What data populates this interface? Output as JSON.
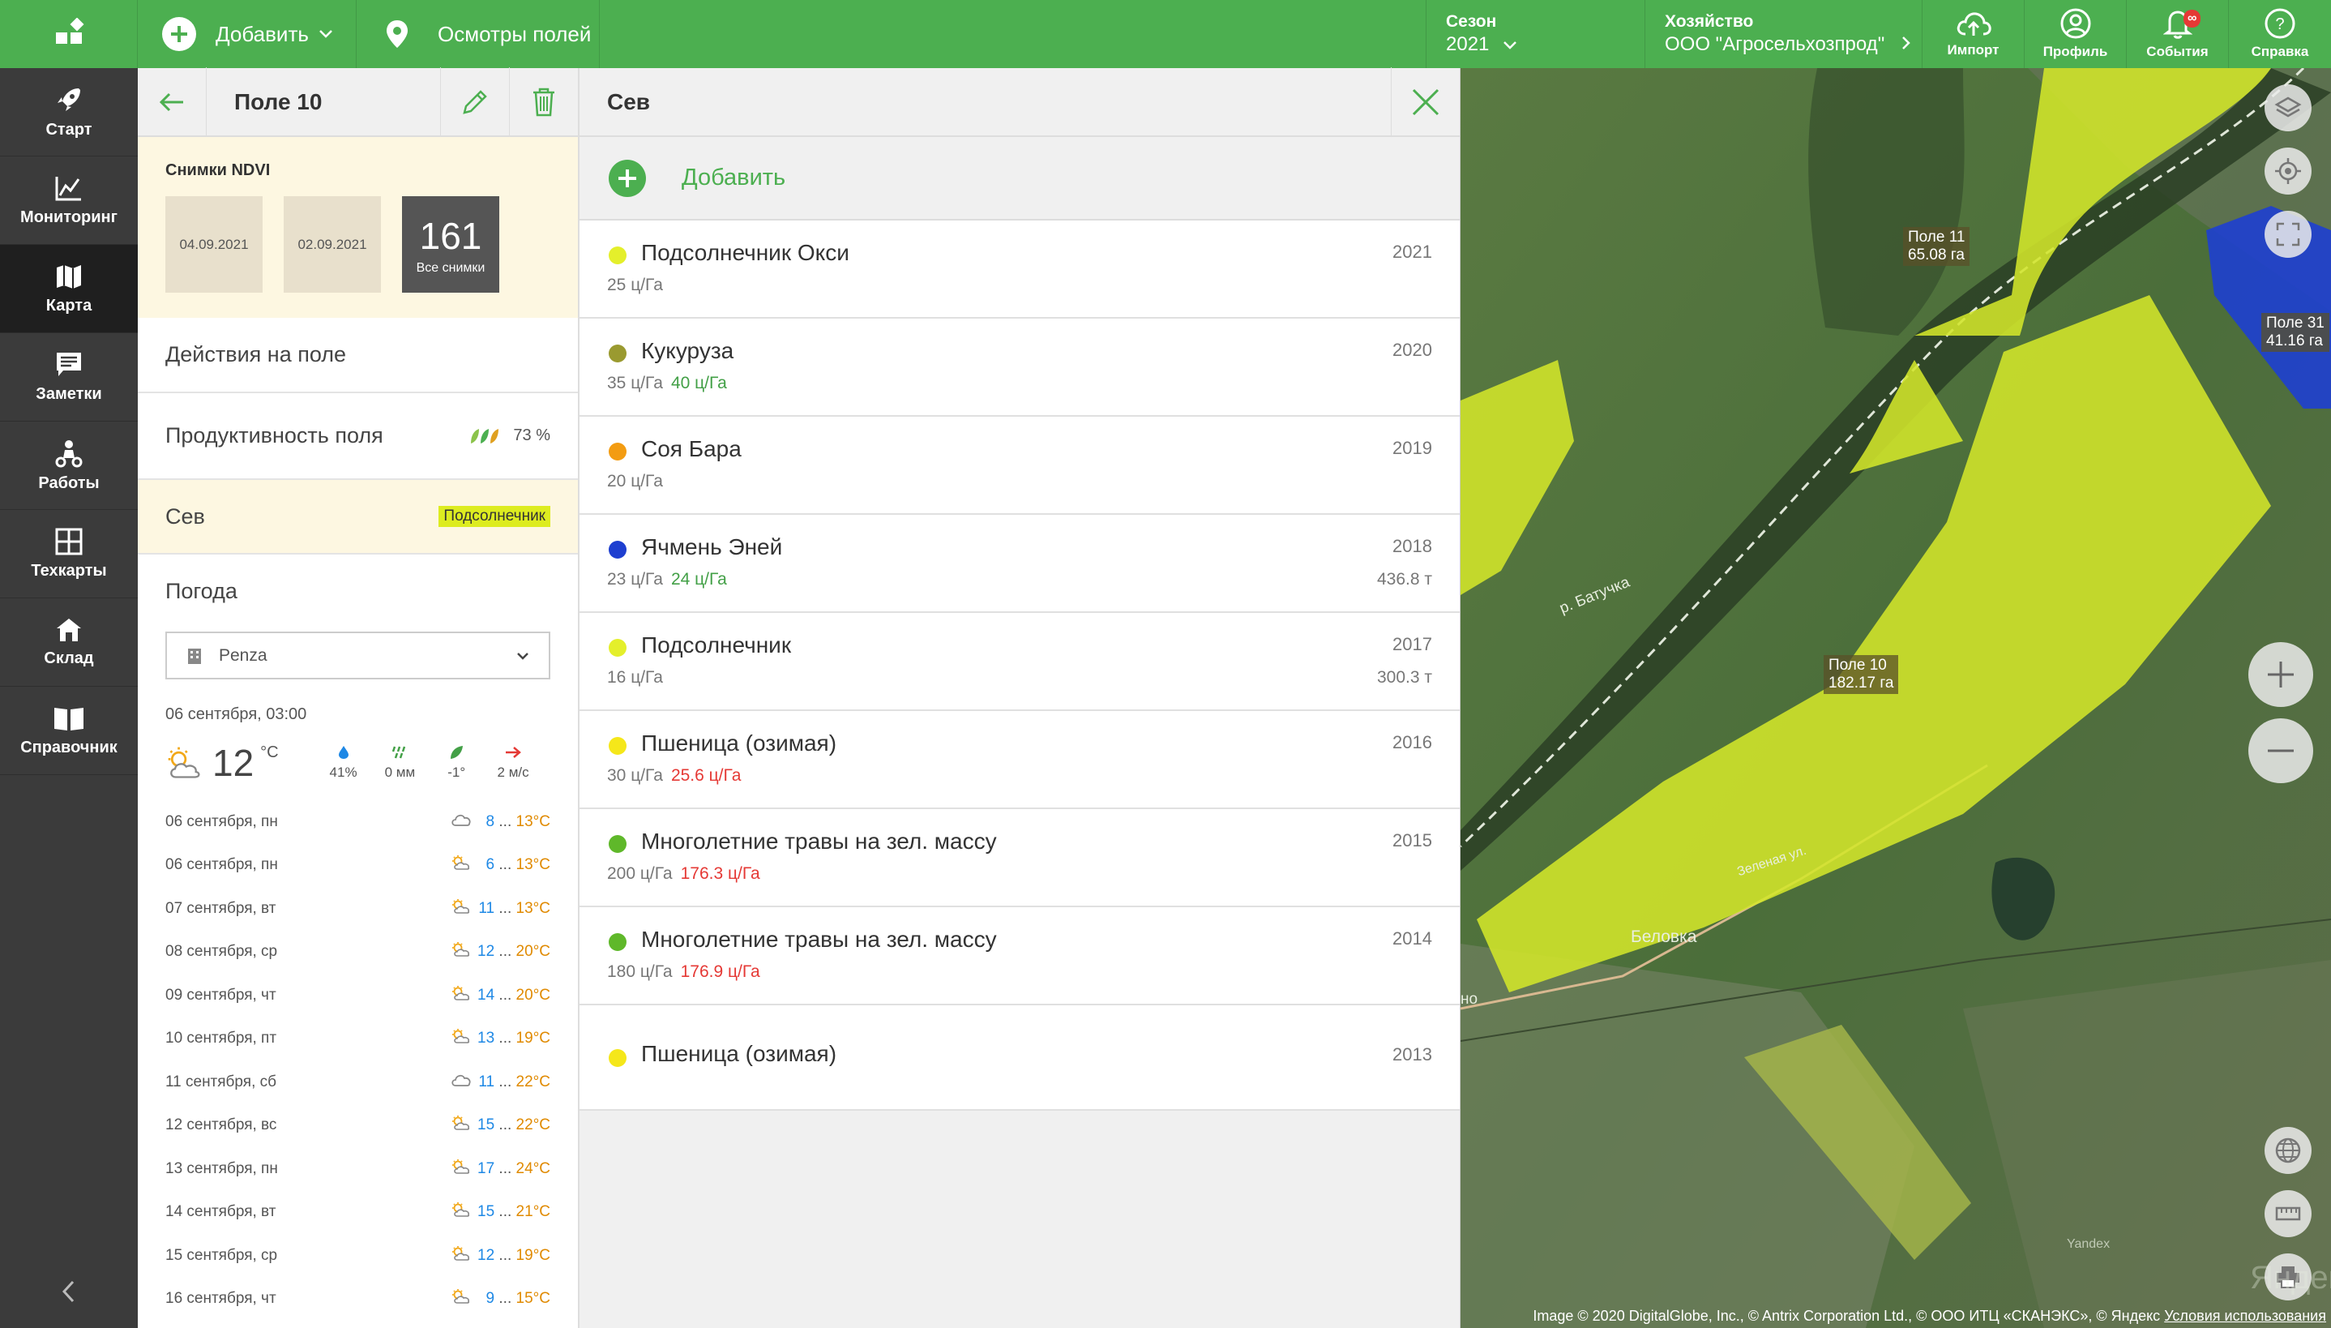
{
  "topbar": {
    "add_label": "Добавить",
    "inspections_label": "Осмотры полей",
    "season_title": "Сезон",
    "season_value": "2021",
    "farm_title": "Хозяйство",
    "farm_value": "ООО \"Агросельхозпрод\"",
    "import_label": "Импорт",
    "profile_label": "Профиль",
    "events_label": "События",
    "events_badge": "∞",
    "help_label": "Справка"
  },
  "nav": {
    "items": [
      {
        "label": "Старт",
        "icon": "rocket-icon"
      },
      {
        "label": "Мониторинг",
        "icon": "chart-icon"
      },
      {
        "label": "Карта",
        "icon": "map-icon"
      },
      {
        "label": "Заметки",
        "icon": "notes-icon"
      },
      {
        "label": "Работы",
        "icon": "tractor-icon"
      },
      {
        "label": "Техкарты",
        "icon": "grid-icon"
      },
      {
        "label": "Склад",
        "icon": "warehouse-icon"
      },
      {
        "label": "Справочник",
        "icon": "book-icon"
      }
    ],
    "active": "Карта"
  },
  "field": {
    "title": "Поле 10",
    "ndvi_title": "Снимки NDVI",
    "ndvi_thumbs": [
      "04.09.2021",
      "02.09.2021"
    ],
    "ndvi_count": "161",
    "ndvi_all_label": "Все снимки",
    "actions_label": "Действия на поле",
    "productivity_label": "Продуктивность поля",
    "productivity_value": "73 %",
    "sowing_label": "Сев",
    "sowing_badge": "Подсолнечник"
  },
  "weather": {
    "title": "Погода",
    "location": "Penza",
    "datetime": "06 сентября, 03:00",
    "temp": "12",
    "unit": "°C",
    "humidity": "41%",
    "precip": "0 мм",
    "leaf_temp": "-1°",
    "wind": "2 м/с",
    "days": [
      {
        "date": "06 сентября, пн",
        "lo": "8",
        "hi": "13",
        "icon": "cloud-icon"
      },
      {
        "date": "06 сентября, пн",
        "lo": "6",
        "hi": "13",
        "icon": "sun-cloud-icon"
      },
      {
        "date": "07 сентября, вт",
        "lo": "11",
        "hi": "13",
        "icon": "sun-cloud-icon"
      },
      {
        "date": "08 сентября, ср",
        "lo": "12",
        "hi": "20",
        "icon": "sun-cloud-icon"
      },
      {
        "date": "09 сентября, чт",
        "lo": "14",
        "hi": "20",
        "icon": "sun-cloud-icon"
      },
      {
        "date": "10 сентября, пт",
        "lo": "13",
        "hi": "19",
        "icon": "sun-cloud-icon"
      },
      {
        "date": "11 сентября, сб",
        "lo": "11",
        "hi": "22",
        "icon": "cloud-icon"
      },
      {
        "date": "12 сентября, вс",
        "lo": "15",
        "hi": "22",
        "icon": "sun-cloud-icon"
      },
      {
        "date": "13 сентября, пн",
        "lo": "17",
        "hi": "24",
        "icon": "sun-cloud-icon"
      },
      {
        "date": "14 сентября, вт",
        "lo": "15",
        "hi": "21",
        "icon": "sun-cloud-icon"
      },
      {
        "date": "15 сентября, ср",
        "lo": "12",
        "hi": "19",
        "icon": "sun-cloud-icon"
      },
      {
        "date": "16 сентября, чт",
        "lo": "9",
        "hi": "15",
        "icon": "sun-cloud-icon"
      }
    ],
    "range_sep": "...",
    "deg": "°C"
  },
  "sowing": {
    "title": "Сев",
    "add_label": "Добавить",
    "crops": [
      {
        "name": "Подсолнечник Окси",
        "year": "2021",
        "plan": "25 ц/Га",
        "fact": "",
        "fact_color": "",
        "total": "",
        "color": "#e4ef2b"
      },
      {
        "name": "Кукуруза",
        "year": "2020",
        "plan": "35 ц/Га",
        "fact": "40 ц/Га",
        "fact_color": "g",
        "total": "",
        "color": "#9a9a30"
      },
      {
        "name": "Соя Бара",
        "year": "2019",
        "plan": "20 ц/Га",
        "fact": "",
        "fact_color": "",
        "total": "",
        "color": "#f39c12"
      },
      {
        "name": "Ячмень Эней",
        "year": "2018",
        "plan": "23 ц/Га",
        "fact": "24 ц/Га",
        "fact_color": "g",
        "total": "436.8 т",
        "color": "#1e3fd0"
      },
      {
        "name": "Подсолнечник",
        "year": "2017",
        "plan": "16 ц/Га",
        "fact": "",
        "fact_color": "",
        "total": "300.3 т",
        "color": "#e4ef2b"
      },
      {
        "name": "Пшеница (озимая)",
        "year": "2016",
        "plan": "30 ц/Га",
        "fact": "25.6 ц/Га",
        "fact_color": "r",
        "total": "",
        "color": "#f5e71a"
      },
      {
        "name": "Многолетние травы на зел. массу",
        "year": "2015",
        "plan": "200 ц/Га",
        "fact": "176.3 ц/Га",
        "fact_color": "r",
        "total": "",
        "color": "#5fb82a"
      },
      {
        "name": "Многолетние травы на зел. массу",
        "year": "2014",
        "plan": "180 ц/Га",
        "fact": "176.9 ц/Га",
        "fact_color": "r",
        "total": "",
        "color": "#5fb82a"
      },
      {
        "name": "Пшеница (озимая)",
        "year": "2013",
        "plan": "",
        "fact": "",
        "fact_color": "",
        "total": "",
        "color": "#f5e71a"
      }
    ]
  },
  "map": {
    "labels": [
      {
        "name": "Поле 11",
        "area": "65.08 га"
      },
      {
        "name": "Поле 31",
        "area": "41.16 га"
      },
      {
        "name": "Поле 10",
        "area": "182.17 га"
      }
    ],
    "places": [
      "р. Батучка",
      "Беловка",
      "Зеленая ул.",
      "Yandex",
      "но"
    ],
    "credit": "Image © 2020 DigitalGlobe, Inc., © Antrix Corporation Ltd., © ООО ИТЦ «СКАНЭКС», © Яндекс",
    "terms": "Условия использования",
    "watermark": "Яндекс"
  },
  "colors": {
    "brand": "#4caf50",
    "nav_bg": "#3b3b3b",
    "field_yellow": "#d9ec2a",
    "field_blue": "#1e3fd0"
  }
}
